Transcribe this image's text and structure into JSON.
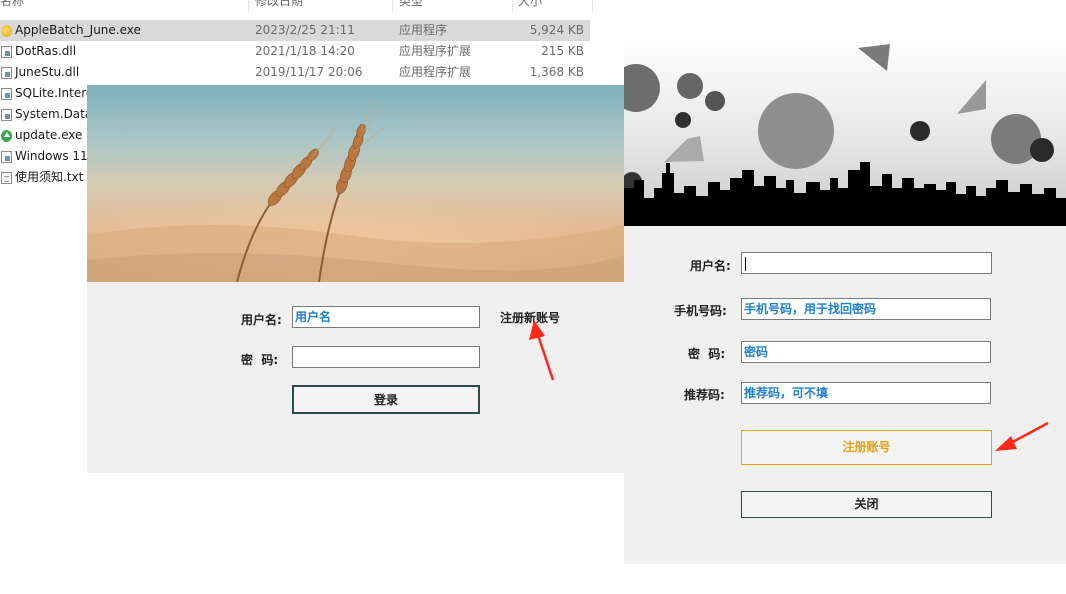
{
  "explorer": {
    "columns": {
      "name": "名称",
      "date": "修改日期",
      "type": "类型",
      "size": "大小"
    },
    "files": [
      {
        "name": "AppleBatch_June.exe",
        "date": "2023/2/25 21:11",
        "type": "应用程序",
        "size": "5,924 KB",
        "icon": "exe-icon",
        "selected": true
      },
      {
        "name": "DotRas.dll",
        "date": "2021/1/18 14:20",
        "type": "应用程序扩展",
        "size": "215 KB",
        "icon": "dll-file-icon"
      },
      {
        "name": "JuneStu.dll",
        "date": "2019/11/17 20:06",
        "type": "应用程序扩展",
        "size": "1,368 KB",
        "icon": "dll-file-icon"
      },
      {
        "name": "SQLite.Interc",
        "icon": "dll-file-icon"
      },
      {
        "name": "System.Data",
        "icon": "dll-file-icon"
      },
      {
        "name": "update.exe",
        "icon": "update-icon"
      },
      {
        "name": "Windows 11",
        "icon": "dll-file-icon"
      },
      {
        "name": "使用须知.txt",
        "icon": "text-file-icon"
      }
    ]
  },
  "login": {
    "username_label": "用户名:",
    "username_value": "用户名",
    "password_label": "密  码:",
    "password_value": "",
    "login_button": "登录",
    "register_link": "注册新账号"
  },
  "register": {
    "username_label": "用户名:",
    "username_value": "",
    "phone_label": "手机号码:",
    "phone_value": "手机号码，用于找回密码",
    "password_label": "密  码:",
    "password_value": "密码",
    "referral_label": "推荐码:",
    "referral_value": "推荐码，可不填",
    "register_button": "注册账号",
    "close_button": "关闭"
  },
  "colors": {
    "field_text": "#1f7fd0",
    "register_button_text": "#e3a21a",
    "register_button_border": "#e3a21a",
    "button_border": "#2f4a4a",
    "annotation_arrow": "#ff2a1a"
  }
}
